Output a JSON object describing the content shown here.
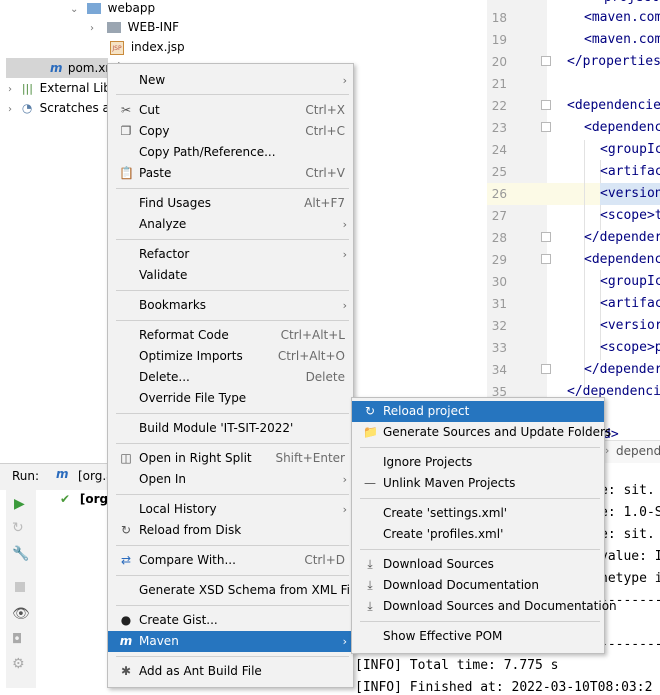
{
  "project_tree": [
    {
      "label": "webapp",
      "icon": "folder-icon"
    },
    {
      "label": "WEB-INF",
      "icon": "folder-icon"
    },
    {
      "label": "index.jsp",
      "icon": "jsp-file-icon"
    },
    {
      "label": "pom.xml",
      "icon": "maven-file-icon"
    },
    {
      "label": "External Lib",
      "icon": "libraries-icon"
    },
    {
      "label": "Scratches a",
      "icon": "scratches-icon"
    }
  ],
  "editor": {
    "line_numbers": [
      "18",
      "19",
      "20",
      "21",
      "22",
      "23",
      "24",
      "25",
      "26",
      "27",
      "28",
      "29",
      "30",
      "31",
      "32",
      "33",
      "34",
      "35"
    ],
    "lines": [
      "<maven.com",
      "<maven.com",
      "</properties",
      "",
      "<dependencie",
      "<dependenc",
      "<groupIc",
      "<artifac",
      "<version",
      "<scope>t",
      "</depender",
      "<dependenc",
      "<groupIc",
      "<artifac",
      "<versior",
      "<scope>p",
      "</depender",
      "</dependenci"
    ]
  },
  "context_menu": {
    "items": [
      {
        "label": "New",
        "shortcut": "",
        "submenu": true
      },
      {
        "label": "Cut",
        "shortcut": "Ctrl+X",
        "icon": "cut-icon"
      },
      {
        "label": "Copy",
        "shortcut": "Ctrl+C",
        "icon": "copy-icon"
      },
      {
        "label": "Copy Path/Reference...",
        "shortcut": ""
      },
      {
        "label": "Paste",
        "shortcut": "Ctrl+V",
        "icon": "paste-icon"
      },
      {
        "label": "Find Usages",
        "shortcut": "Alt+F7"
      },
      {
        "label": "Analyze",
        "shortcut": "",
        "submenu": true
      },
      {
        "label": "Refactor",
        "shortcut": "",
        "submenu": true
      },
      {
        "label": "Validate",
        "shortcut": ""
      },
      {
        "label": "Bookmarks",
        "shortcut": "",
        "submenu": true
      },
      {
        "label": "Reformat Code",
        "shortcut": "Ctrl+Alt+L"
      },
      {
        "label": "Optimize Imports",
        "shortcut": "Ctrl+Alt+O"
      },
      {
        "label": "Delete...",
        "shortcut": "Delete"
      },
      {
        "label": "Override File Type",
        "shortcut": ""
      },
      {
        "label": "Build Module 'IT-SIT-2022'",
        "shortcut": ""
      },
      {
        "label": "Open in Right Split",
        "shortcut": "Shift+Enter",
        "icon": "split-icon"
      },
      {
        "label": "Open In",
        "shortcut": "",
        "submenu": true
      },
      {
        "label": "Local History",
        "shortcut": "",
        "submenu": true
      },
      {
        "label": "Reload from Disk",
        "shortcut": "",
        "icon": "reload-icon"
      },
      {
        "label": "Compare With...",
        "shortcut": "Ctrl+D",
        "icon": "compare-icon"
      },
      {
        "label": "Generate XSD Schema from XML File...",
        "shortcut": ""
      },
      {
        "label": "Create Gist...",
        "shortcut": "",
        "icon": "github-icon"
      },
      {
        "label": "Maven",
        "shortcut": "",
        "submenu": true,
        "icon": "maven-icon"
      },
      {
        "label": "Add as Ant Build File",
        "shortcut": "",
        "icon": "ant-icon"
      }
    ]
  },
  "maven_submenu": {
    "items": [
      {
        "label": "Reload project",
        "icon": "reload-icon"
      },
      {
        "label": "Generate Sources and Update Folders",
        "icon": "generate-icon"
      },
      {
        "label": "Ignore Projects"
      },
      {
        "label": "Unlink Maven Projects",
        "icon": "minus-icon"
      },
      {
        "label": "Create 'settings.xml'"
      },
      {
        "label": "Create 'profiles.xml'"
      },
      {
        "label": "Download Sources",
        "icon": "download-icon"
      },
      {
        "label": "Download Documentation",
        "icon": "download-icon"
      },
      {
        "label": "Download Sources and Documentation",
        "icon": "download-icon"
      },
      {
        "label": "Show Effective POM"
      }
    ]
  },
  "run_panel": {
    "label": "Run:",
    "tab": "[org.a",
    "tree_item": "[org."
  },
  "console": {
    "breadcrumb": "depende",
    "partial_tag": "d>",
    "lines": [
      "e: sit.",
      "e: 1.0-S",
      "e: sit.",
      "value: I",
      "hetype i",
      "--------",
      "--------",
      "[INFO] Total time:  7.775 s",
      "[INFO] Finished at: 2022-03-10T08:03:2"
    ]
  },
  "colors": {
    "selection": "#2675bf",
    "menu_bg": "#f2f2f2"
  }
}
